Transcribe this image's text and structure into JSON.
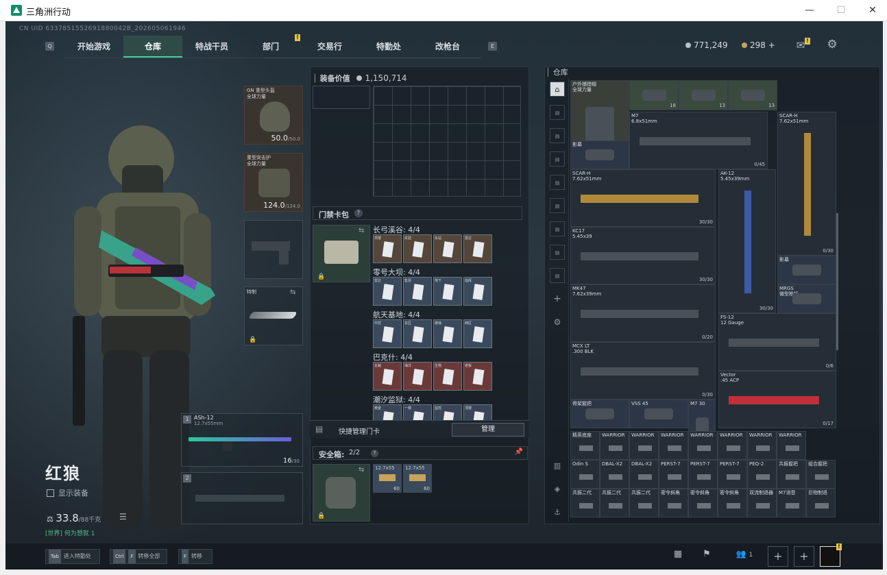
{
  "window": {
    "title": "三角洲行动"
  },
  "header": {
    "uid": "CN UID 6337851552691880042B_202605061946",
    "tabs": [
      "开始游戏",
      "仓库",
      "特战干员",
      "部门",
      "交易行",
      "特勤处",
      "改枪台"
    ],
    "active_tab": "仓库",
    "hint_left": "Q",
    "hint_right": "E",
    "currency_a": "771,249",
    "currency_b": "298 +",
    "colors": {
      "accent": "#43d39c",
      "badge": "#e6c244"
    }
  },
  "character": {
    "name": "红狼",
    "show_equipment": "显示装备",
    "weight": "33.8",
    "weight_max": "/88千克",
    "chat": "[世界] 何为想就 1"
  },
  "equipment": {
    "helmet": {
      "name": "GN 重型头盔\n全球力量",
      "value": "50.0",
      "max": "/50.0"
    },
    "armor": {
      "name": "重型突击护\n全球力量",
      "value": "124.0",
      "max": "/124.0"
    },
    "melee": {
      "name": "特制"
    },
    "primary": {
      "slot": "1",
      "name": "ASh-12",
      "ammo_type": "12.7x55mm",
      "ammo": "16",
      "ammo_max": "/30"
    },
    "secondary": {
      "slot": "2"
    }
  },
  "middle": {
    "equip_value_label": "装备价值",
    "equip_value": "1,150,714",
    "keycard_header": "门禁卡包",
    "keycard_help": "?",
    "quick_manage": "快捷管理门卡",
    "manage_btn": "管理",
    "safebox_label": "安全箱:",
    "safebox_count": "2/2",
    "safebox_item_name": "12.7x55",
    "safebox_item_count": "60",
    "keycard_groups": [
      {
        "title": "长弓溪谷: 4/4",
        "cards": [
          "坝楼",
          "实验",
          "车站",
          "雷达"
        ]
      },
      {
        "title": "零号大坝: 4/4",
        "cards": [
          "雷达",
          "售票",
          "地下",
          "指挥"
        ]
      },
      {
        "title": "航天基地: 4/4",
        "cards": [
          "中控",
          "东区",
          "玻璃",
          "西区"
        ]
      },
      {
        "title": "巴克什: 4/4",
        "cards": [
          "总裁",
          "海洋",
          "生物",
          "老板"
        ]
      },
      {
        "title": "潮汐监狱: 4/4",
        "cards": [
          "黄金",
          "一楼",
          "监控",
          "顶楼"
        ]
      }
    ]
  },
  "depot": {
    "title": "仓库",
    "items": [
      {
        "name": "户外捕猎帽\n全球力量",
        "value": "12.0/12.0"
      },
      {
        "name": "",
        "count": "18"
      },
      {
        "name": "",
        "count": "13"
      },
      {
        "name": "",
        "count": "13"
      },
      {
        "name": "M7\n6.8x51mm",
        "count": "0/45"
      },
      {
        "name": "SCAR-H\n7.62x51mm",
        "count": "0/30"
      },
      {
        "name": "影幕"
      },
      {
        "name": "SCAR-H\n7.62x51mm",
        "count": "30/30"
      },
      {
        "name": "AK-12\n5.45x39mm",
        "count": "30/30"
      },
      {
        "name": "KC17\n5.45x39",
        "count": "30/30"
      },
      {
        "name": "影幕"
      },
      {
        "name": "MRGS\n微型枪托"
      },
      {
        "name": "MK47\n7.62x39mm",
        "count": "0/20"
      },
      {
        "name": "FS-12\n12 Gauge",
        "count": "0/6"
      },
      {
        "name": "MCX LT\n.300 BLK",
        "count": "0/30"
      },
      {
        "name": "Vector\n.45 ACP",
        "count": "0/17"
      },
      {
        "name": "骨架握把"
      },
      {
        "name": "VSS 45"
      },
      {
        "name": "M7 30"
      }
    ],
    "attachments_row1": [
      "精英底座",
      "WARRIOR",
      "WARRIOR",
      "WARRIOR",
      "WARRIOR",
      "WARRIOR",
      "WARRIOR",
      "WARRIOR",
      "WARRIOR"
    ],
    "attachments_row2": [
      "Odin S",
      "DBAL-X2",
      "DBAL-X2",
      "PERST-7",
      "PERST-7",
      "PERST-7",
      "PEQ-2",
      "共振握把",
      "组合握把"
    ],
    "attachments_row3": [
      "共振二代",
      "共振二代",
      "共振二代",
      "密令斜角",
      "密令斜角",
      "密令斜角",
      "双流制退器",
      "M7消音",
      "巨物制退"
    ]
  },
  "bottom": {
    "tab_key": "Tab",
    "tab_label": "进入特勤处",
    "ctrl_key": "Ctrl",
    "f_key": "F",
    "ctrlf_label": "转移全部",
    "f2_key": "F",
    "f_label": "转移",
    "friends": "1"
  }
}
